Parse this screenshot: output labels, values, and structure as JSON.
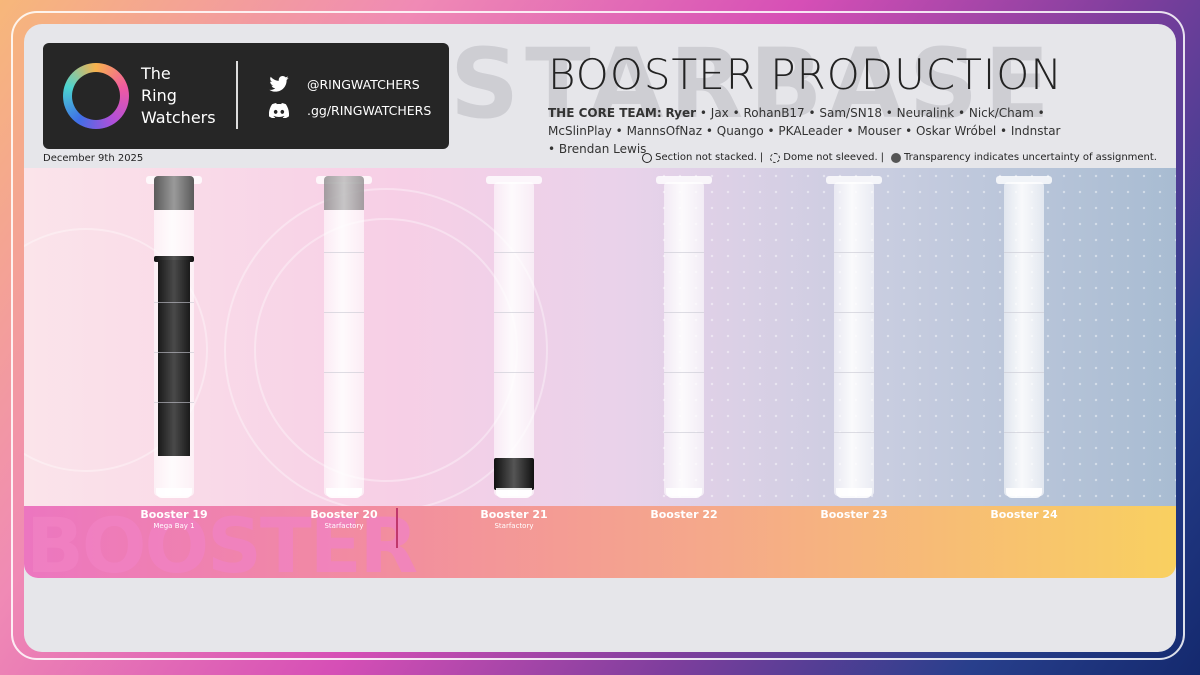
{
  "header": {
    "org_line1": "The",
    "org_line2": "Ring",
    "org_line3": "Watchers",
    "twitter_handle": "@RINGWATCHERS",
    "discord_link": ".gg/RINGWATCHERS",
    "title": "BOOSTER PRODUCTION",
    "watermark": "STARBASE",
    "team_label": "THE CORE TEAM:",
    "team_lead": "Ryer",
    "team_members": "• Jax • RohanB17 • Sam/SN18 • Neuralink • Nick/Cham • McSlinPlay • MannsOfNaz • Quango • PKALeader • Mouser • Oskar Wróbel • Indnstar • Brendan Lewis",
    "date": "December 9th 2025"
  },
  "legend": {
    "not_stacked": "Section not stacked.",
    "not_sleeved": "Dome not sleeved.",
    "transparency": "Transparency indicates uncertainty of assignment.",
    "separator": "|"
  },
  "band_word": "BOOSTER",
  "boosters": [
    {
      "name": "Booster 19",
      "location": "Mega Bay 1"
    },
    {
      "name": "Booster 20",
      "location": "Starfactory"
    },
    {
      "name": "Booster 21",
      "location": "Starfactory"
    },
    {
      "name": "Booster 22",
      "location": ""
    },
    {
      "name": "Booster 23",
      "location": ""
    },
    {
      "name": "Booster 24",
      "location": ""
    }
  ],
  "icons": {
    "twitter": "twitter-icon",
    "discord": "discord-icon",
    "logo": "ring-logo-icon"
  },
  "colors": {
    "accent_pink": "#ec76c0",
    "accent_yellow": "#f9d060",
    "dark_panel": "#262626"
  }
}
